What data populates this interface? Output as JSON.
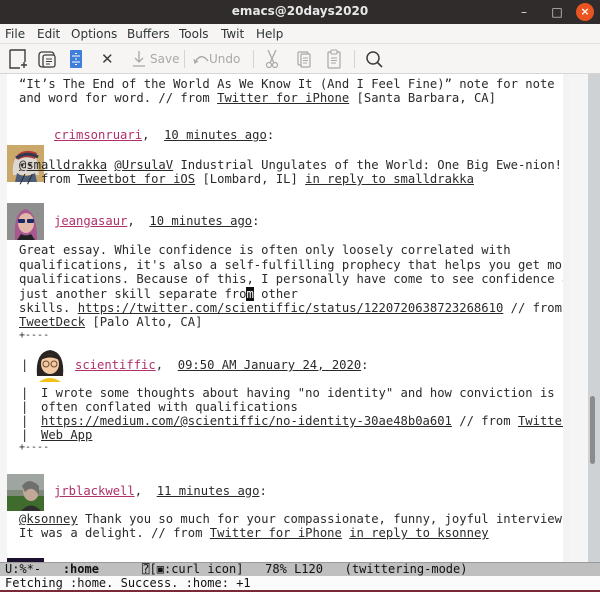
{
  "window": {
    "title": "emacs@20days2020",
    "controls": {
      "minimize": "–",
      "maximize": "□",
      "close": "×"
    }
  },
  "menubar": {
    "items": [
      "File",
      "Edit",
      "Options",
      "Buffers",
      "Tools",
      "Twit",
      "Help"
    ]
  },
  "toolbar": {
    "new_file": "new-file-icon",
    "open_dir": "open-folder-icon",
    "dired": "file-cabinet-icon",
    "close_glyph": "✕",
    "save_label": "Save",
    "undo_label": "Undo",
    "cut": "scissors-icon",
    "copy": "copy-icon",
    "paste": "paste-icon",
    "search": "search-icon"
  },
  "tweets": {
    "t0": {
      "line1": "“It’s The End of the World As We Know It (And I Feel Fine)” note for note",
      "line2_pre": "and word for word. // from ",
      "line2_source": "Twitter for iPhone",
      "line2_post": " [Santa Barbara, CA]"
    },
    "t1": {
      "user": "crimsonruari",
      "time": "10 minutes ago",
      "mention1": "@smalldrakka",
      "mention2": "@UrsulaV",
      "text1": " Industrial Ungulates of the World: One Big Ewe-nion!",
      "text2_pre": "// from ",
      "source": "Tweetbot for iOS",
      "location": " [Lombard, IL] ",
      "reply": "in reply to smalldrakka"
    },
    "t2": {
      "user": "jeangasaur",
      "time": "10 minutes ago",
      "line1": "Great essay. While confidence is often only loosely correlated with",
      "line2": "qualifications, it's also a self-fulfilling prophecy that helps you get more",
      "line3": "qualifications. Because of this, I personally have come to see confidence as",
      "line4_pre": "just another skill separate fro",
      "line4_cursor": "m",
      "line4_post": " other",
      "line5_pre": "skills. ",
      "line5_url": "https://twitter.com/scientiffic/status/1220720638723268610",
      "line5_post": " // from",
      "line6_source": "TweetDeck",
      "line6_post": " [Palo Alto, CA]",
      "quote_open": "+----",
      "quote": {
        "user": "scientiffic",
        "time": "09:50 AM January 24, 2020",
        "line1": "I wrote some thoughts about having \"no identity\" and how conviction is",
        "line2": "often conflated with qualifications",
        "url": "https://medium.com/@scientiffic/no-identity-30ae48b0a601",
        "from": " // from ",
        "source1": "Twitter",
        "source2": "Web App"
      },
      "quote_close": "+----"
    },
    "t3": {
      "user": "jrblackwell",
      "time": "11 minutes ago",
      "mention": "@ksonney",
      "text1": " Thank you so much for your compassionate, funny, joyful interview!",
      "text2_pre": "It was a delight. // from ",
      "source": "Twitter for iPhone",
      "reply": "in reply to ksonney"
    }
  },
  "modeline": {
    "state": "U:%*-",
    "buffer": ":home",
    "icon_info": "[▣:curl icon]",
    "percent": "78%",
    "line": "L120",
    "mode": "(twittering-mode)"
  },
  "echo_area": "Fetching :home. Success. :home: +1",
  "scroll": {
    "position_fraction": 0.78
  },
  "colors": {
    "username": "#b0306a",
    "close_button": "#e95420",
    "modeline_bg": "#bfbfbf"
  }
}
